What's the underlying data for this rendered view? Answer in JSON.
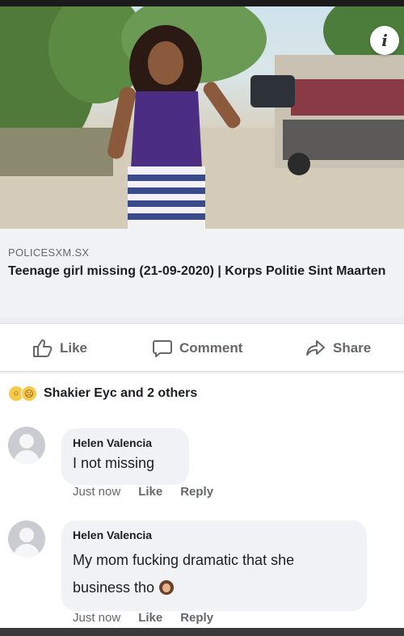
{
  "post": {
    "info_icon": "info-icon",
    "link": {
      "domain": "POLICESXM.SX",
      "title": "Teenage girl missing (21-09-2020) | Korps Politie Sint Maarten"
    },
    "actions": {
      "like": "Like",
      "comment": "Comment",
      "share": "Share"
    },
    "reactions": {
      "icons": [
        "wow-icon",
        "sad-icon"
      ],
      "text": "Shakier Eyc and 2 others"
    }
  },
  "comments": [
    {
      "author": "Helen Valencia",
      "text": "I not missing",
      "time": "Just now",
      "like_label": "Like",
      "reply_label": "Reply"
    },
    {
      "author": "Helen Valencia",
      "text": "My mom fucking dramatic that she business tho",
      "emoji": "woman-frowning-emoji",
      "time": "Just now",
      "like_label": "Like",
      "reply_label": "Reply"
    }
  ],
  "colors": {
    "secondary_text": "#65676b",
    "bubble": "#f0f2f5",
    "primary_text": "#1c1e21"
  }
}
